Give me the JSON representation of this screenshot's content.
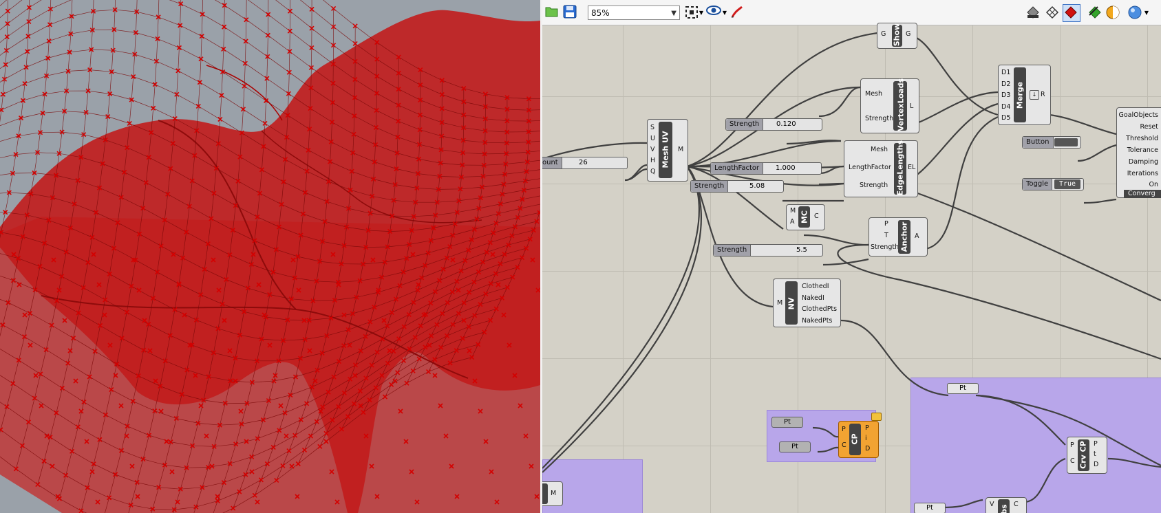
{
  "toolbar": {
    "zoom_value": "85%",
    "buttons": [
      "open-file-icon",
      "save-file-icon",
      "zoom-extents-icon",
      "preview-eye-icon",
      "sketch-pen-icon",
      "preview-off-icon",
      "preview-wire-icon",
      "preview-shaded-icon",
      "preview-selected-icon",
      "display-toggle-icon",
      "sphere-icon"
    ]
  },
  "viewport": {
    "mesh_color": "#c01818",
    "background": "#9aa1a9"
  },
  "components": {
    "show": {
      "title": "Show",
      "inputs": [
        "G"
      ],
      "outputs": [
        "G"
      ]
    },
    "mesh_uv": {
      "title": "Mesh UV",
      "inputs": [
        "S",
        "U",
        "V",
        "H",
        "Q"
      ],
      "outputs": [
        "M"
      ]
    },
    "vertex_loads": {
      "title": "VertexLoads",
      "inputs": [
        "Mesh",
        "Strength"
      ],
      "outputs": [
        "L"
      ]
    },
    "edge_lengths": {
      "title": "EdgeLengths",
      "inputs": [
        "Mesh",
        "LengthFactor",
        "Strength"
      ],
      "outputs": [
        "EL"
      ]
    },
    "merge": {
      "title": "Merge",
      "inputs": [
        "D1",
        "D2",
        "D3",
        "D4",
        "D5"
      ],
      "outputs": [
        "R"
      ]
    },
    "mc": {
      "title": "MC",
      "inputs": [
        "M",
        "A"
      ],
      "outputs": [
        "C"
      ]
    },
    "anchor": {
      "title": "Anchor",
      "inputs": [
        "P",
        "T",
        "Strength"
      ],
      "outputs": [
        "A"
      ]
    },
    "nv": {
      "title": "NV",
      "inputs": [
        "M"
      ],
      "outputs": [
        "ClothedI",
        "NakedI",
        "ClothedPts",
        "NakedPts"
      ]
    },
    "solver": {
      "inputs": [
        "GoalObjects",
        "Reset",
        "Threshold",
        "Tolerance",
        "Damping",
        "Iterations",
        "On"
      ],
      "footer": "Converg"
    },
    "cp": {
      "title": "CP",
      "inputs": [
        "P",
        "C"
      ],
      "outputs": [
        "P",
        "i",
        "D"
      ]
    },
    "crv_cp": {
      "title": "Crv CP",
      "inputs": [
        "P",
        "C"
      ],
      "outputs": [
        "P",
        "t",
        "D"
      ]
    },
    "bottom_left": {
      "outputs": [
        "M"
      ]
    },
    "bottom_mid": {
      "title": "bs",
      "inputs": [
        "V"
      ],
      "outputs": [
        "C"
      ]
    }
  },
  "sliders": {
    "count": {
      "label": "ount",
      "value": "26"
    },
    "vl_strength": {
      "label": "Strength",
      "value": "0.120"
    },
    "length_factor": {
      "label": "LengthFactor",
      "value": "1.000"
    },
    "el_strength": {
      "label": "Strength",
      "value": "5.08"
    },
    "anchor_strength": {
      "label": "Strength",
      "value": "5.5"
    }
  },
  "button": {
    "label": "Button"
  },
  "toggle": {
    "label": "Toggle",
    "value": "True"
  },
  "points": {
    "pt_a": "Pt",
    "pt_b": "Pt",
    "pt_c": "Pt",
    "pt_d": "Pt"
  }
}
